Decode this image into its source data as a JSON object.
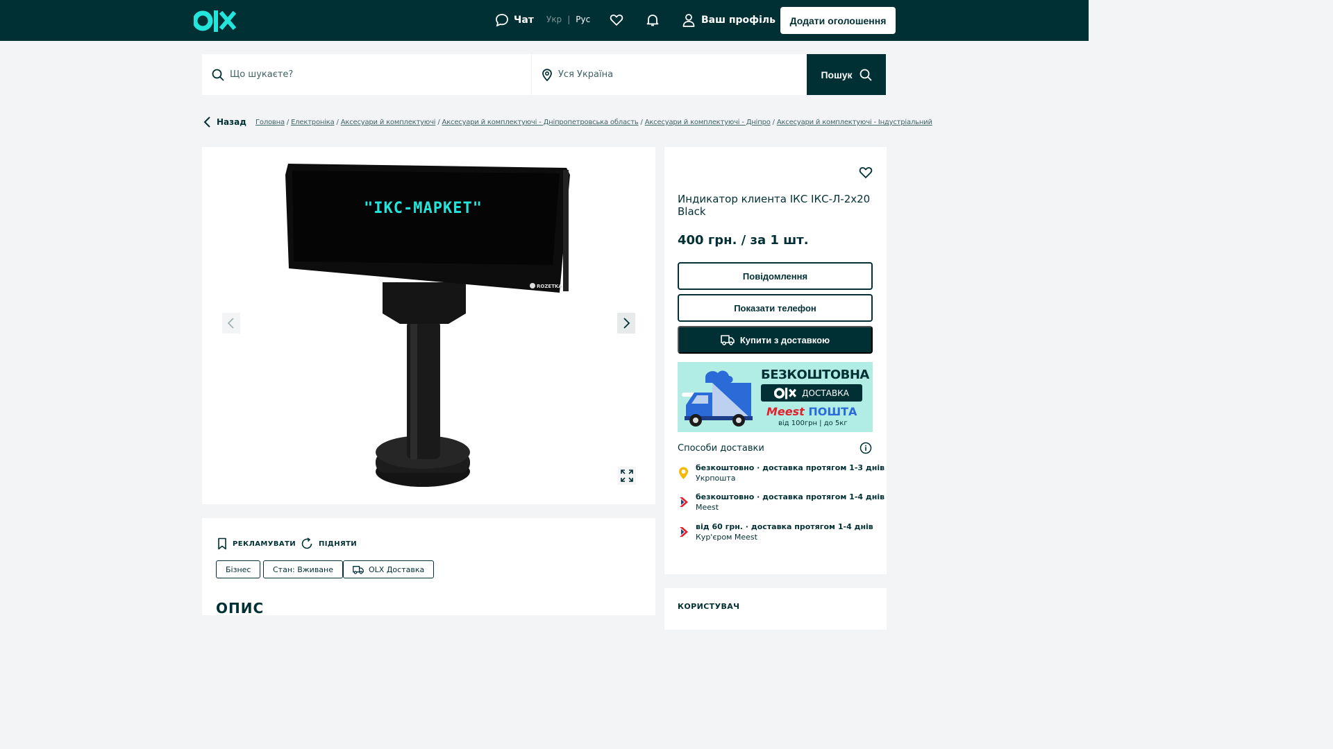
{
  "header": {
    "chat_label": "Чат",
    "lang_ukr": "Укр",
    "lang_sep": "|",
    "lang_rus": "Рус",
    "profile_label": "Ваш профіль",
    "post_ad_label": "Додати оголошення"
  },
  "search": {
    "query_placeholder": "Що шукаєте?",
    "location_placeholder": "Уся Україна",
    "button_label": "Пошук"
  },
  "breadcrumb": {
    "back_label": "Назад",
    "items": [
      "Головна",
      "Електроніка",
      "Аксесуари й комплектуючі",
      "Аксесуари й комплектуючі - Дніпропетровська область",
      "Аксесуари й комплектуючі - Дніпро",
      "Аксесуари й комплектуючі - Індустріальний"
    ]
  },
  "gallery": {
    "display_text": "\"IKC-MAPKET\"",
    "watermark": "ROZETKA"
  },
  "listing": {
    "title": "Индикатор клиента ІКС ІКС-Л-2х20 Black",
    "price": "400 грн. / за 1 шт.",
    "message_button": "Повідомлення",
    "phone_button": "Показати телефон",
    "buy_button": "Купити з доставкою"
  },
  "banner": {
    "line1": "БЕЗКОШТОВНА",
    "line2": "ДОСТАВКА",
    "brand_meest": "Meest",
    "brand_post": "ПОШТА",
    "line4": "від 100грн | до 5кг"
  },
  "delivery": {
    "heading": "Способи доставки",
    "methods": [
      {
        "title": "безкоштовно · доставка протягом 1-3 днів",
        "carrier": "Укрпошта"
      },
      {
        "title": "безкоштовно · доставка протягом 1-4 днів",
        "carrier": "Meest"
      },
      {
        "title": "від 60 грн. · доставка протягом 1-4 днів",
        "carrier": "Кур'єром Meest"
      }
    ]
  },
  "actions": {
    "promote_label": "РЕКЛАМУВАТИ",
    "raise_label": "ПІДНЯТИ"
  },
  "tags": [
    "Бізнес",
    "Стан: Вживане",
    "OLX Доставка"
  ],
  "description_heading": "ОПИС",
  "user_heading": "КОРИСТУВАЧ",
  "colors": {
    "brand_dark": "#002f34",
    "brand_teal": "#23e5db",
    "page_bg": "#f2f4f5",
    "banner_bg": "#b2ede5"
  }
}
